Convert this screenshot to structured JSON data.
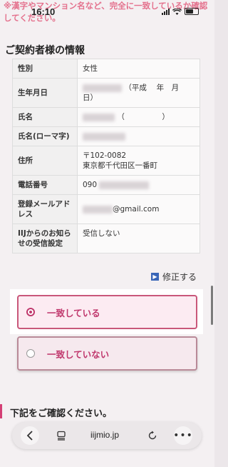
{
  "status": {
    "time": "16:10"
  },
  "notice": "※漢字やマンション名など、完全に一致しているか確認してください。",
  "section_title": "ご契約者様の情報",
  "info_rows": [
    {
      "label": "性別",
      "value": "女性"
    },
    {
      "label": "生年月日",
      "value": "（平成　 年　月　日）"
    },
    {
      "label": "氏名",
      "value": "（　　　　　）"
    },
    {
      "label": "氏名(ローマ字)",
      "value": ""
    },
    {
      "label": "住所",
      "value": "〒102-0082",
      "value2": "東京都千代田区一番町"
    },
    {
      "label": "電話番号",
      "value": "090"
    },
    {
      "label": "登録メールアドレス",
      "value": "@gmail.com"
    },
    {
      "label": "IIJからのお知らせの受信設定",
      "value": "受信しない"
    }
  ],
  "edit_link": "修正する",
  "options": [
    {
      "label": "一致している",
      "selected": true
    },
    {
      "label": "一致していない",
      "selected": false
    }
  ],
  "section2_title": "下記をご確認ください。",
  "browser": {
    "url": "iijmio.jp"
  },
  "colors": {
    "accent": "#c0386d",
    "notice": "#e4718d",
    "link_icon": "#3a66b8"
  }
}
